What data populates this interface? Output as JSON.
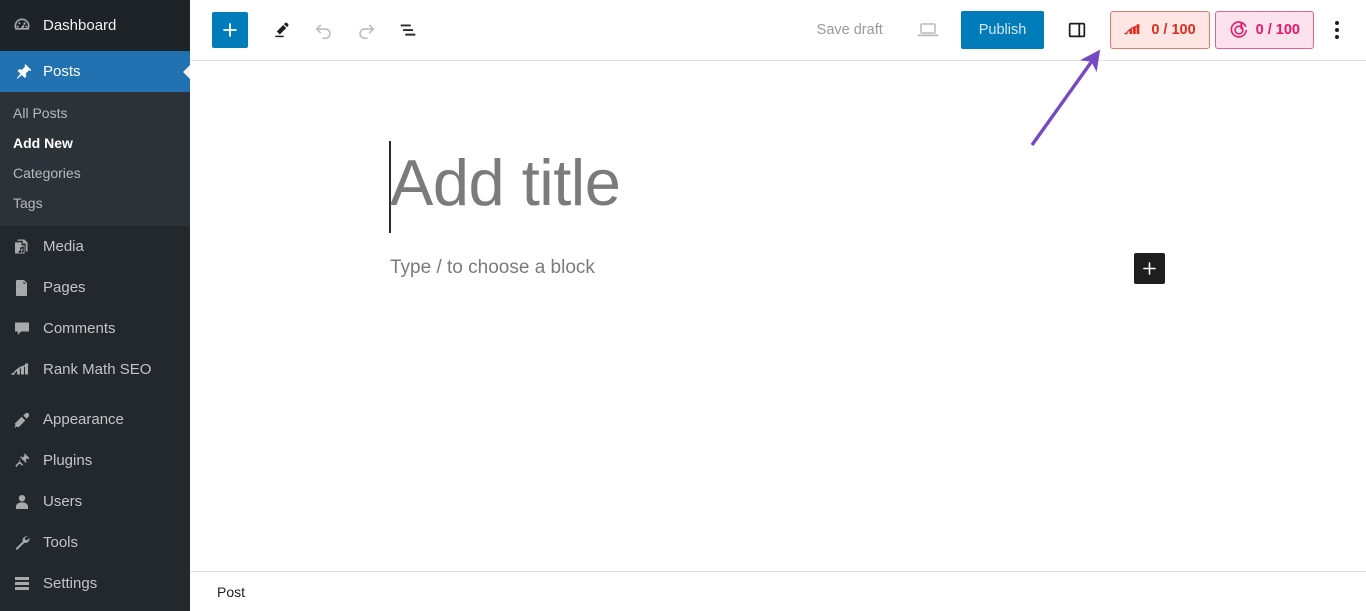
{
  "sidebar": {
    "dashboard": {
      "label": "Dashboard",
      "icon": "dashboard-gauge-icon"
    },
    "posts": {
      "label": "Posts",
      "icon": "pin-icon"
    },
    "posts_submenu": [
      {
        "label": "All Posts",
        "current": false
      },
      {
        "label": "Add New",
        "current": true
      },
      {
        "label": "Categories",
        "current": false
      },
      {
        "label": "Tags",
        "current": false
      }
    ],
    "group_media": [
      {
        "label": "Media",
        "icon": "media-icon"
      },
      {
        "label": "Pages",
        "icon": "pages-icon"
      },
      {
        "label": "Comments",
        "icon": "comments-icon"
      },
      {
        "label": "Rank Math SEO",
        "icon": "rank-math-icon"
      }
    ],
    "group_admin": [
      {
        "label": "Appearance",
        "icon": "appearance-brush-icon"
      },
      {
        "label": "Plugins",
        "icon": "plugins-plug-icon"
      },
      {
        "label": "Users",
        "icon": "users-icon"
      },
      {
        "label": "Tools",
        "icon": "tools-wrench-icon"
      },
      {
        "label": "Settings",
        "icon": "settings-gear-icon"
      }
    ]
  },
  "toolbar": {
    "add_block_label": "+",
    "add_block_name": "toggle-block-inserter",
    "tools_icon": "pencil-tools-icon",
    "undo_icon": "undo-arrow-icon",
    "redo_icon": "redo-arrow-icon",
    "outline_icon": "document-overview-icon",
    "save_draft_label": "Save draft",
    "preview_icon": "preview-laptop-icon",
    "publish_label": "Publish",
    "settings_icon": "settings-sidebar-icon",
    "seo_score": {
      "label": "0 / 100",
      "icon": "rank-math-seo-score-icon",
      "bg": "#fde6e3",
      "border": "#e8776a",
      "color": "#e02b20"
    },
    "ai_score": {
      "label": "0 / 100",
      "icon": "content-ai-icon",
      "bg": "#fbe2ec",
      "border": "#e8608f",
      "color": "#e5186a"
    },
    "more_icon": "more-options-kebab-icon"
  },
  "editor": {
    "title_placeholder": "Add title",
    "block_placeholder": "Type / to choose a block",
    "inserter_icon": "add-block-plus-icon"
  },
  "footer": {
    "breadcrumb": "Post"
  },
  "annotation": {
    "color": "#7748c4",
    "type": "arrow-pointing-to-seo-score"
  },
  "colors": {
    "sidebar_bg": "#23282d",
    "sidebar_top_bg": "#1d2327",
    "sidebar_submenu_bg": "#2c3338",
    "active_blue": "#2271b1",
    "primary_blue": "#007cba"
  }
}
